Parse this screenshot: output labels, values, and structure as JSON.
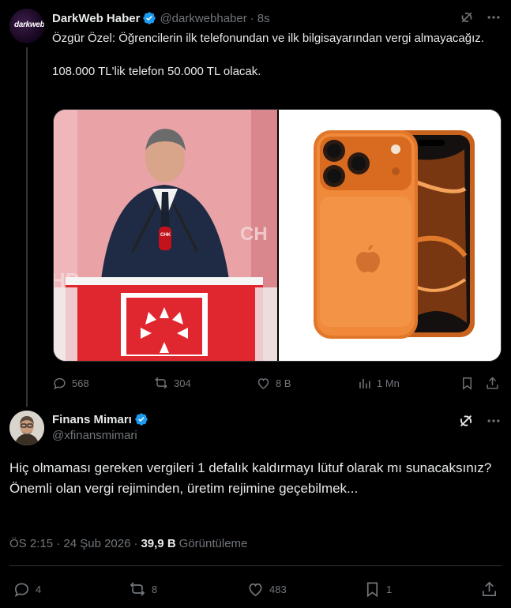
{
  "quoted_tweet": {
    "author_name": "DarkWeb Haber",
    "handle": "@darkwebhaber",
    "separator": "·",
    "time": "8s",
    "avatar_logo": "darkweb",
    "text_line1": "Özgür Özel: Öğrencilerin ilk telefonundan ve ilk bilgisayarından vergi almayacağız.",
    "text_line2": "108.000 TL'lik telefon 50.000 TL olacak.",
    "media": [
      {
        "description_icon": "politician-at-podium-photo"
      },
      {
        "description_icon": "orange-phone-photo"
      }
    ],
    "actions": {
      "replies": "568",
      "reposts": "304",
      "likes": "8 B",
      "views": "1 Mn"
    }
  },
  "main_tweet": {
    "author_name": "Finans Mimarı",
    "handle": "@xfinansmimari",
    "text": "Hiç olmaması gereken vergileri 1 defalık kaldırmayı lütuf olarak mı sunacaksınız? Önemli olan vergi rejiminden, üretim rejimine geçebilmek...",
    "timestamp": "ÖS 2:15 · 24 Şub 2026",
    "meta_separator": "·",
    "views_count": "39,9 B",
    "views_label": "Görüntüleme",
    "actions": {
      "replies": "4",
      "reposts": "8",
      "likes": "483",
      "bookmarks": "1"
    }
  },
  "colors": {
    "background": "#000000",
    "text": "#e7e9ea",
    "muted": "#71767b",
    "verified": "#1d9bf0",
    "border": "#2f3336"
  }
}
